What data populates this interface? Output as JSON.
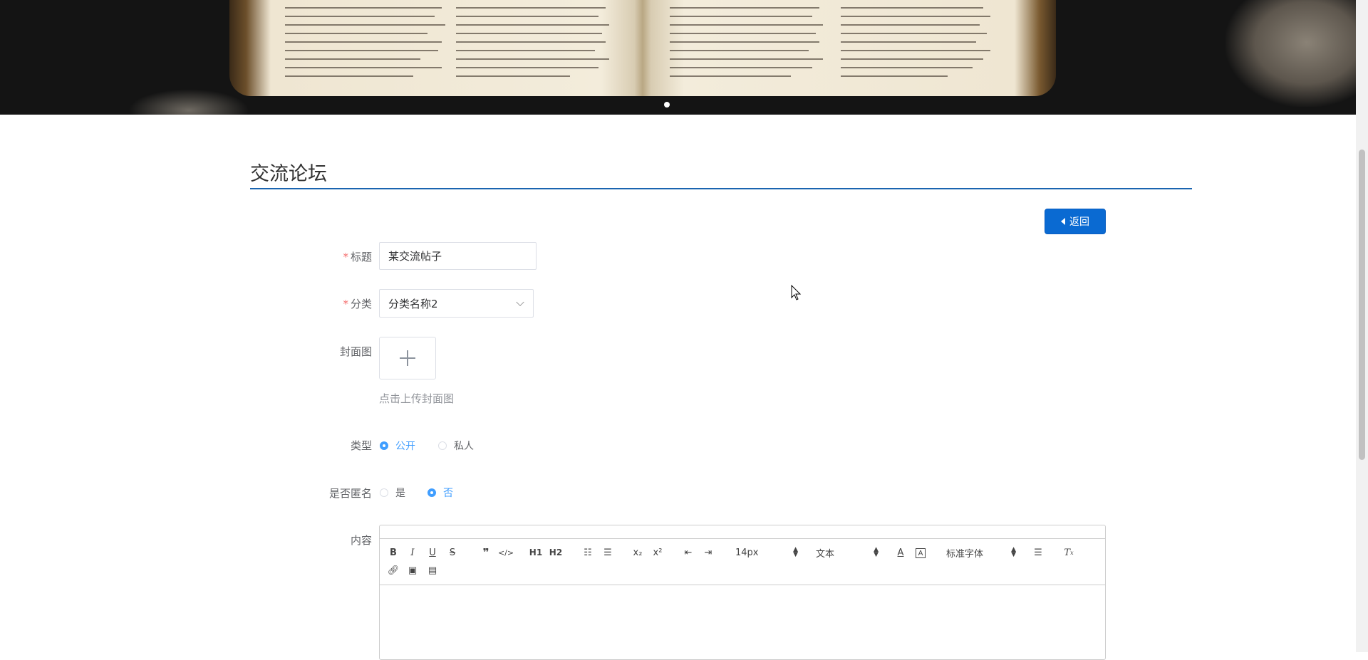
{
  "banner": {
    "carousel_dots": 1
  },
  "section_title": "交流论坛",
  "back_button": "返回",
  "form": {
    "title_label": "标题",
    "title_value": "某交流帖子",
    "category_label": "分类",
    "category_value": "分类名称2",
    "cover_label": "封面图",
    "cover_hint": "点击上传封面图",
    "type_label": "类型",
    "type_options": [
      "公开",
      "私人"
    ],
    "type_selected": "公开",
    "anonymous_label": "是否匿名",
    "anonymous_options": [
      "是",
      "否"
    ],
    "anonymous_selected": "否",
    "content_label": "内容"
  },
  "editor": {
    "toolbar": {
      "size": "14px",
      "header": "文本",
      "font": "标准字体",
      "h1": "H1",
      "h2": "H2",
      "sub": "x₂",
      "sup": "x²"
    }
  },
  "colors": {
    "primary": "#0a6ad2",
    "radio_active": "#409eff",
    "required": "#f56c6c",
    "title_underline": "#1a64b0"
  }
}
